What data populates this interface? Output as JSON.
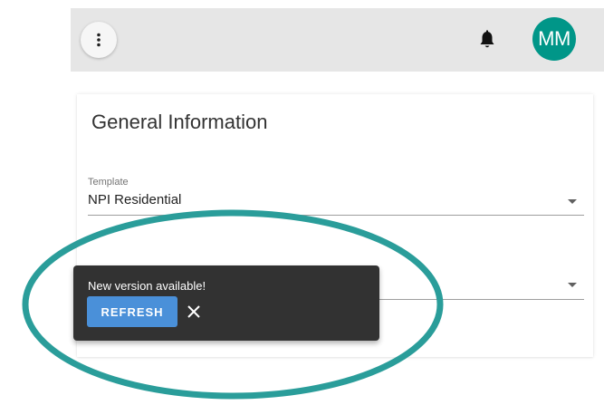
{
  "header": {
    "menu_icon": "more-vert-icon",
    "notification_icon": "bell-icon",
    "avatar_initials": "MM",
    "avatar_color": "#009688"
  },
  "card": {
    "title": "General Information",
    "template_field": {
      "label": "Template",
      "value": "NPI Residential"
    },
    "second_field": {
      "value": ""
    }
  },
  "snackbar": {
    "message": "New version available!",
    "refresh_label": "REFRESH",
    "close_icon": "close-icon",
    "button_color": "#4a90d9"
  },
  "annotation": {
    "ring_color": "#2a9d9a"
  }
}
